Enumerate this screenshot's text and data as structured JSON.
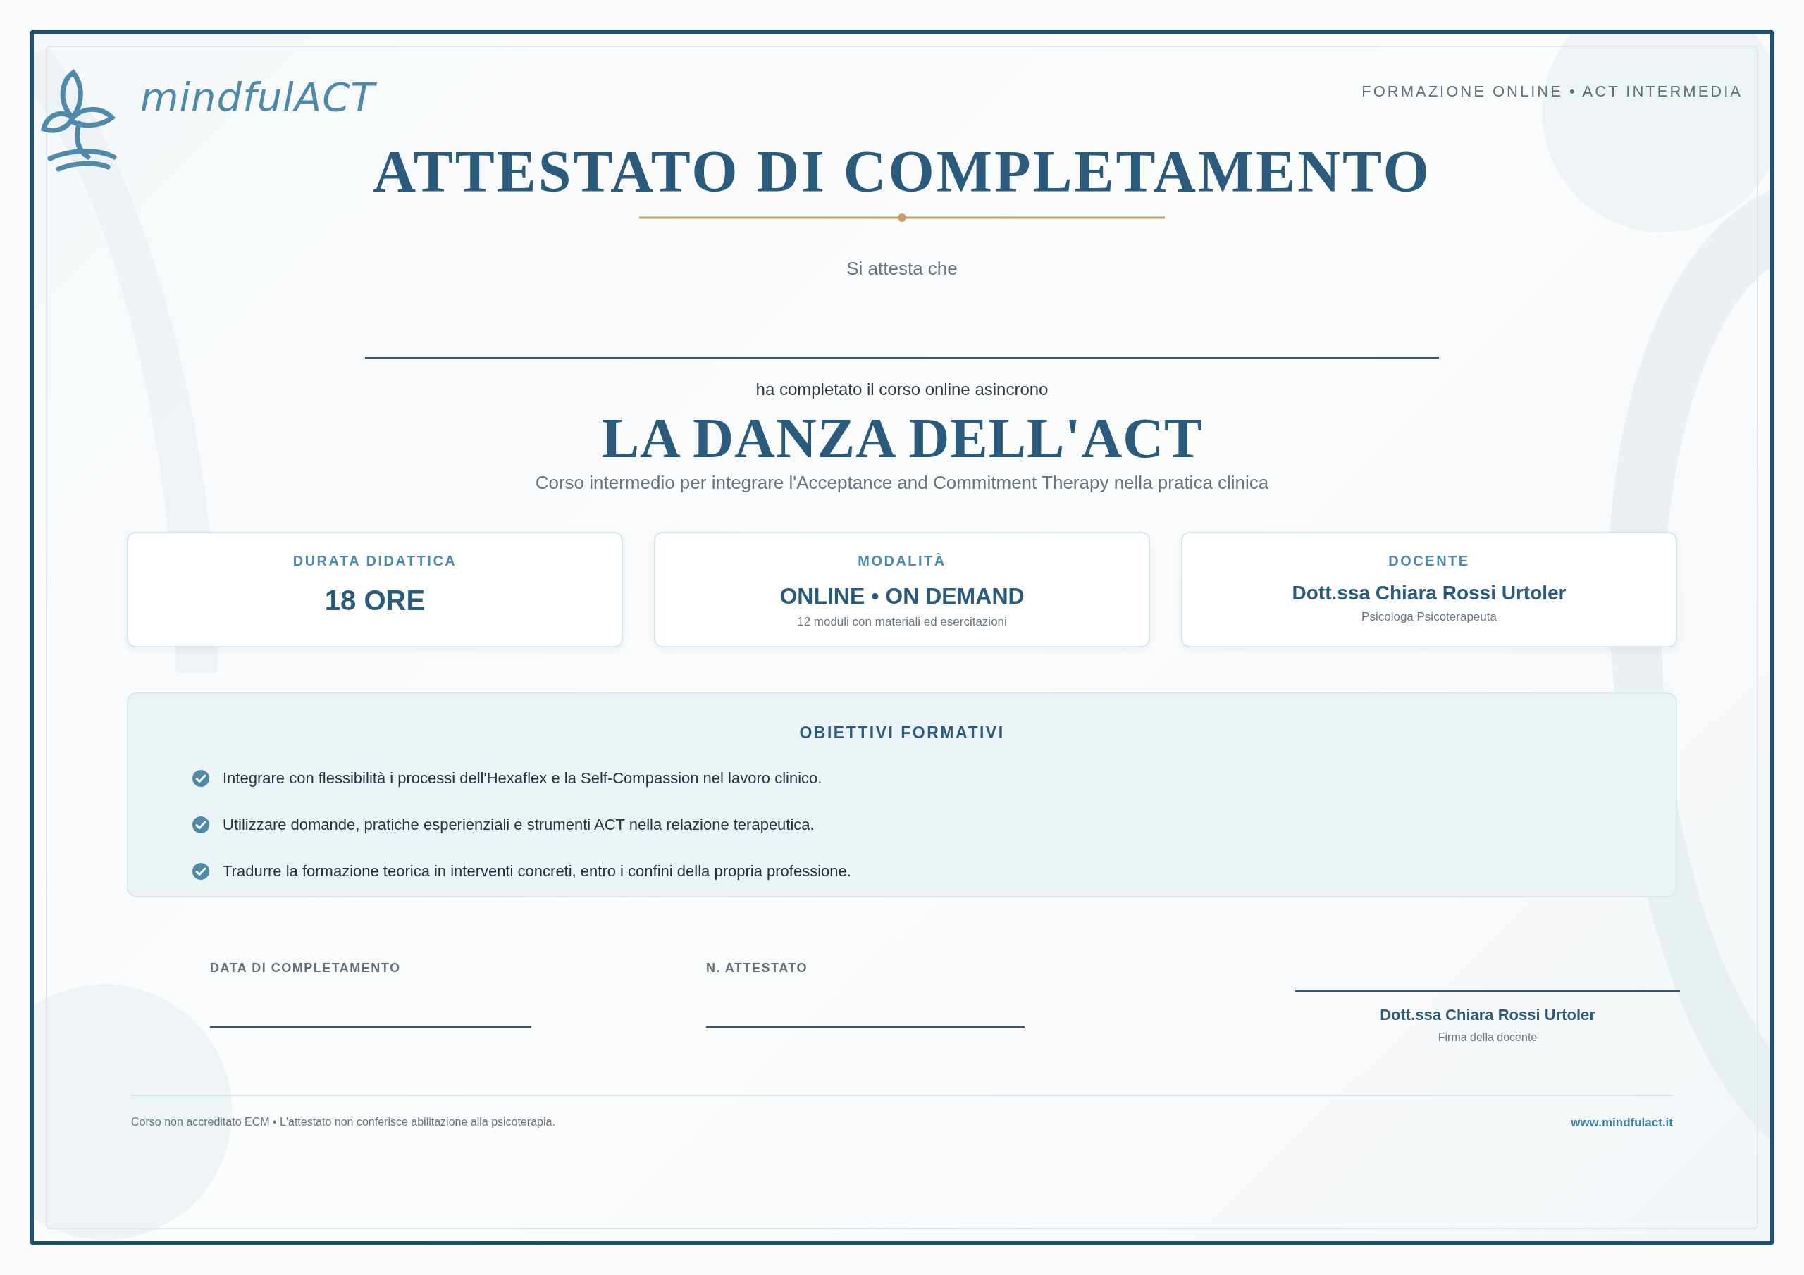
{
  "header": {
    "brand": "mindfulACT",
    "tagline": "FORMAZIONE ONLINE • ACT INTERMEDIA"
  },
  "title": "ATTESTATO DI COMPLETAMENTO",
  "intro": "Si attesta che",
  "completed_text": "ha completato il corso online asincrono",
  "course": {
    "title": "LA DANZA DELL'ACT",
    "subtitle": "Corso intermedio per integrare l'Acceptance and Commitment Therapy nella pratica clinica"
  },
  "cards": [
    {
      "kind": "metric",
      "label": "DURATA DIDATTICA",
      "value": "18 ORE"
    },
    {
      "kind": "mode",
      "label": "MODALITÀ",
      "value": "ONLINE • ON DEMAND",
      "note": "12 moduli con materiali ed esercitazioni"
    },
    {
      "kind": "person",
      "label": "DOCENTE",
      "value": "Dott.ssa Chiara Rossi Urtoler",
      "note": "Psicologa Psicoterapeuta"
    }
  ],
  "objectives": {
    "heading": "OBIETTIVI FORMATIVI",
    "items": [
      "Integrare con flessibilità i processi dell'Hexaflex e la Self-Compassion nel lavoro clinico.",
      "Utilizzare domande, pratiche esperienziali e strumenti ACT nella relazione terapeutica.",
      "Tradurre la formazione teorica in interventi concreti, entro i confini della propria professione."
    ]
  },
  "fields": [
    {
      "label": "DATA DI COMPLETAMENTO"
    },
    {
      "label": "N. ATTESTATO"
    }
  ],
  "signature": {
    "name": "Dott.ssa Chiara Rossi Urtoler",
    "caption": "Firma della docente"
  },
  "footer": {
    "note": "Corso non accreditato ECM • L'attestato non conferisce abilitazione alla psicoterapia.",
    "website": "www.mindfulact.it"
  }
}
